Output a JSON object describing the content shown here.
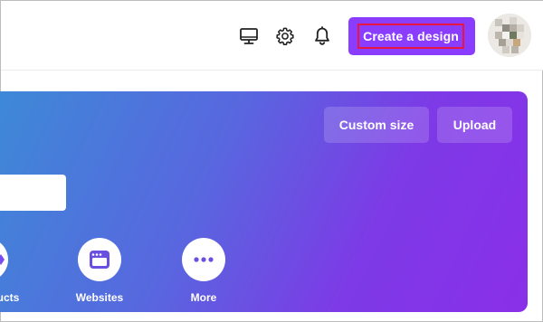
{
  "header": {
    "create_button_label": "Create a design",
    "icons": [
      "desktop-icon",
      "gear-icon",
      "bell-icon"
    ]
  },
  "hero": {
    "custom_size_label": "Custom size",
    "upload_label": "Upload",
    "categories": [
      {
        "label": "oducts",
        "icon": "products-icon"
      },
      {
        "label": "Websites",
        "icon": "browser-window-icon"
      },
      {
        "label": "More",
        "icon": "ellipsis-icon"
      }
    ]
  },
  "colors": {
    "accent": "#8b3dff",
    "highlight_border": "#e8173f",
    "gradient_start": "#3d8ad7",
    "gradient_end": "#8a2fe9"
  }
}
